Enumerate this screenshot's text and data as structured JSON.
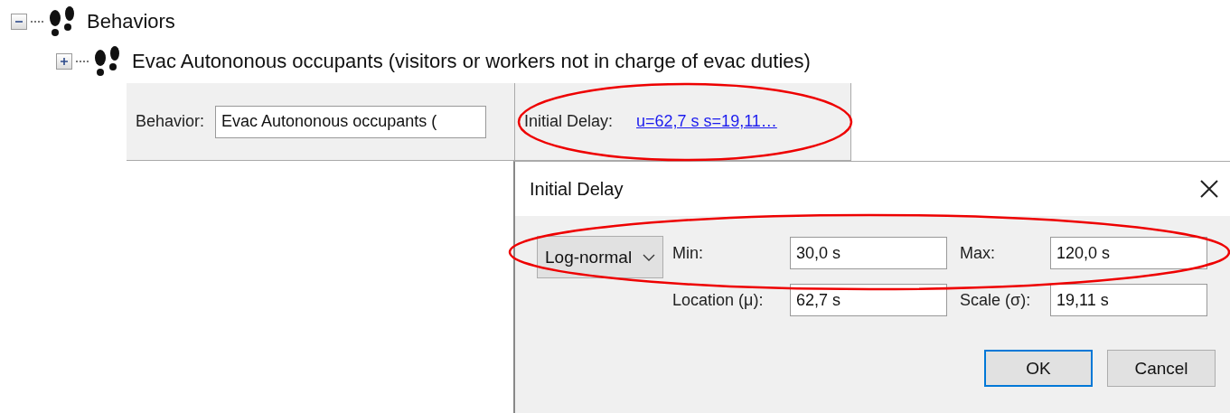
{
  "tree": {
    "label": "Behaviors",
    "expanded": true,
    "children": [
      {
        "label": "Evac Autononous occupants (visitors or workers not in charge of evac duties)",
        "expanded": false
      }
    ]
  },
  "behavior_panel": {
    "label": "Behavior:",
    "value": "Evac Autononous occupants ("
  },
  "delay_panel": {
    "label": "Initial Delay:",
    "link": "u=62,7 s s=19,11…"
  },
  "dialog": {
    "title": "Initial Delay",
    "distribution": "Log-normal",
    "fields": [
      {
        "label": "Min:",
        "value": "30,0 s"
      },
      {
        "label": "Max:",
        "value": "120,0 s"
      },
      {
        "label": "Location (μ):",
        "value": "62,7 s"
      },
      {
        "label": "Scale (σ):",
        "value": "19,11 s"
      }
    ],
    "buttons": [
      {
        "label": "OK",
        "default": true
      },
      {
        "label": "Cancel",
        "default": false
      }
    ]
  }
}
